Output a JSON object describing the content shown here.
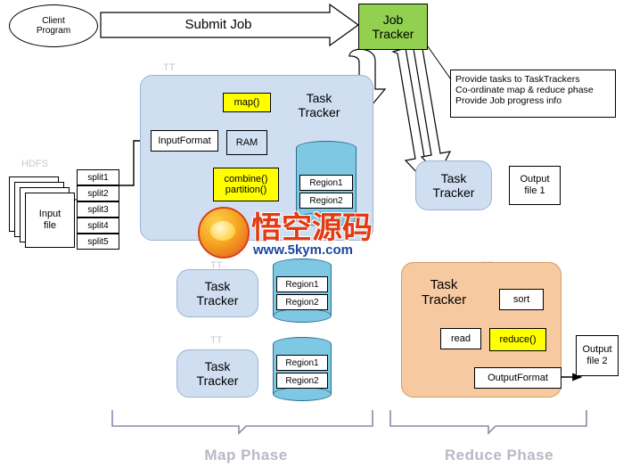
{
  "title_flow": {
    "submit_job_label": "Submit Job"
  },
  "client": {
    "line1": "Client",
    "line2": "Program"
  },
  "job_tracker": {
    "line1": "Job",
    "line2": "Tracker"
  },
  "callout": {
    "line1": "Provide tasks to TaskTrackers",
    "line2": "Co-ordinate map & reduce phase",
    "line3": "Provide Job progress info"
  },
  "input": {
    "file_label": "Input\nfile",
    "splits": [
      "split1",
      "split2",
      "split3",
      "split4",
      "split5"
    ]
  },
  "map_node": {
    "task_tracker_line1": "Task",
    "task_tracker_line2": "Tracker",
    "input_format": "InputFormat",
    "map_fn": "map()",
    "ram": "RAM",
    "combine_partition_line1": "combine()",
    "combine_partition_line2": "partition()",
    "regions": [
      "Region1",
      "Region2"
    ]
  },
  "task_trackers": [
    {
      "line1": "Task",
      "line2": "Tracker"
    },
    {
      "line1": "Task",
      "line2": "Tracker"
    },
    {
      "line1": "Task",
      "line2": "Tracker"
    },
    {
      "line1": "Task",
      "line2": "Tracker"
    }
  ],
  "region_stores": [
    {
      "regions": [
        "Region1",
        "Region2"
      ]
    },
    {
      "regions": [
        "Region1",
        "Region2"
      ]
    }
  ],
  "reduce_node": {
    "task_tracker_line1": "Task",
    "task_tracker_line2": "Tracker",
    "read": "read",
    "sort": "sort",
    "reduce_fn": "reduce()",
    "output_format": "OutputFormat"
  },
  "outputs": [
    {
      "line1": "Output",
      "line2": "file 1"
    },
    {
      "line1": "Output",
      "line2": "file 2"
    }
  ],
  "phases": {
    "map_phase": "Map Phase",
    "reduce_phase": "Reduce Phase"
  },
  "faded_labels": {
    "l1": "TT",
    "l2": "HDFS",
    "l3": "TT",
    "l4": "TT",
    "l5": "TT"
  },
  "watermark": {
    "title": "悟空源码",
    "subtitle": "www.5kym.com"
  },
  "colors": {
    "job_tracker": "#92d050",
    "map_panel": "#cfdff1",
    "reduce_panel": "#f6c9a0",
    "highlight_yellow": "#ffff00",
    "cylinder": "#7ec8e3"
  }
}
